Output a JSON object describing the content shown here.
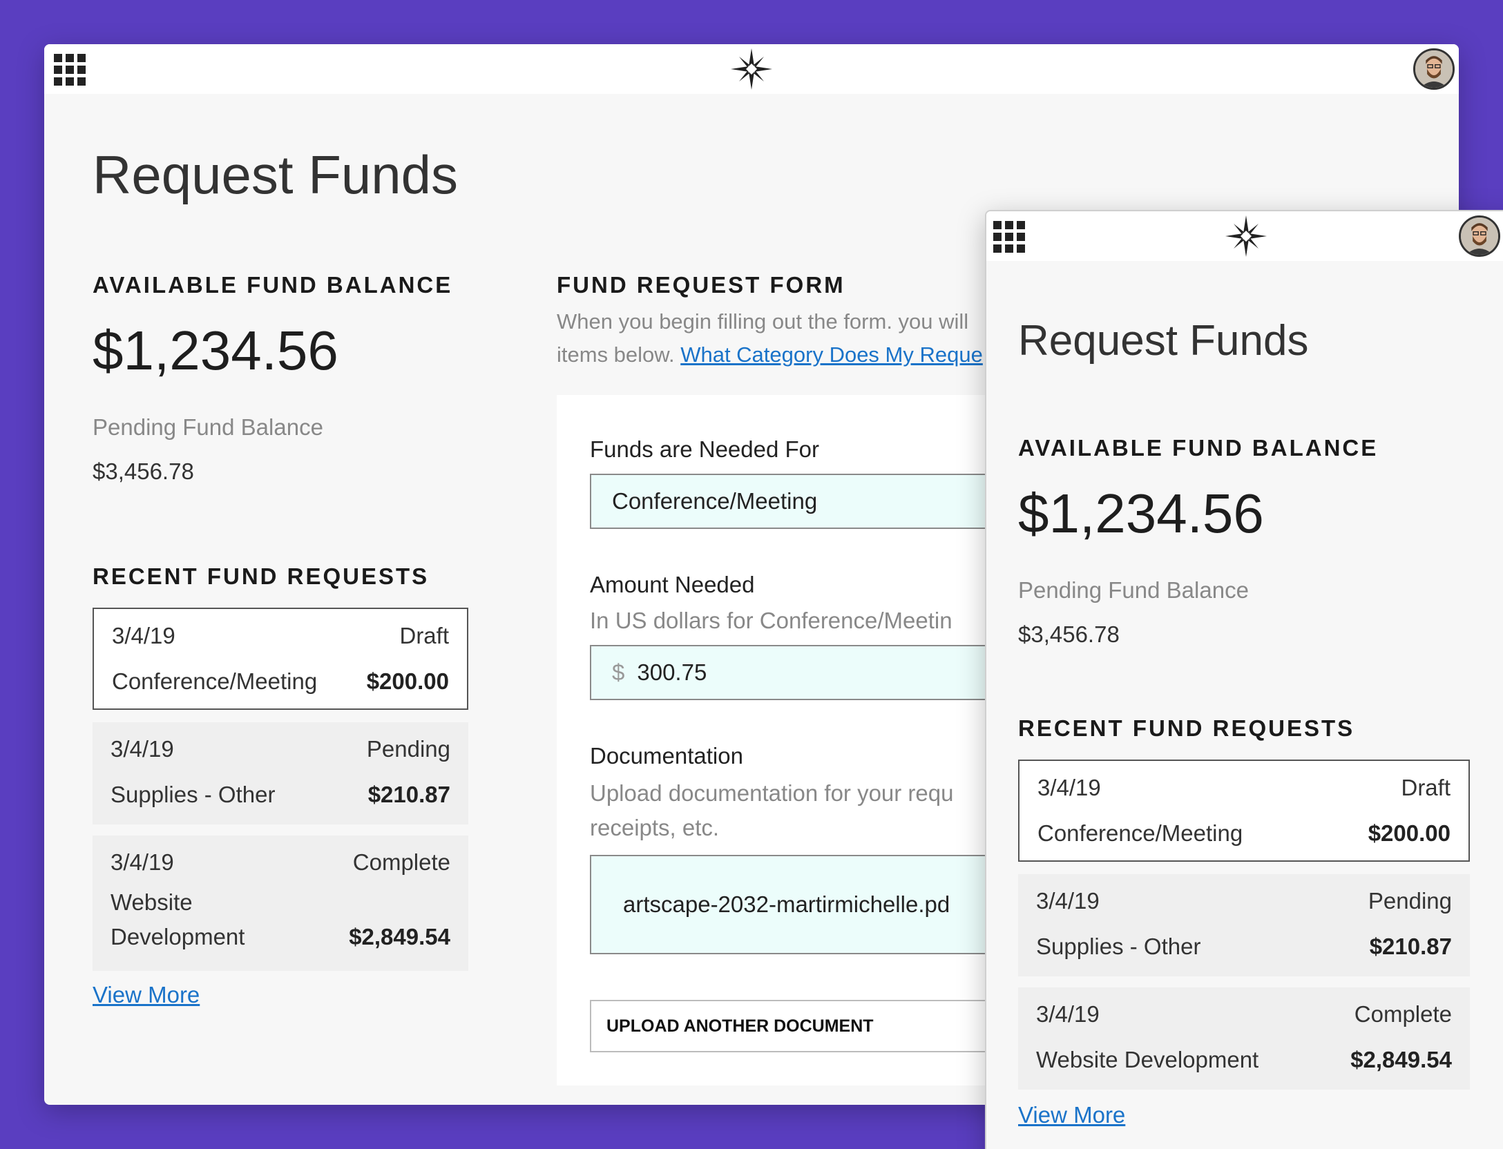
{
  "desktop": {
    "title": "Request Funds",
    "balance": {
      "heading": "AVAILABLE FUND BALANCE",
      "amount": "$1,234.56",
      "pending_label": "Pending Fund Balance",
      "pending_amount": "$3,456.78"
    },
    "recent": {
      "heading": "RECENT FUND REQUESTS",
      "items": [
        {
          "date": "3/4/19",
          "status": "Draft",
          "category": "Conference/Meeting",
          "amount": "$200.00"
        },
        {
          "date": "3/4/19",
          "status": "Pending",
          "category": "Supplies - Other",
          "amount": "$210.87"
        },
        {
          "date": "3/4/19",
          "status": "Complete",
          "category_line1": "Website",
          "category_line2": "Development",
          "amount": "$2,849.54"
        }
      ],
      "view_more": "View More"
    },
    "form": {
      "heading": "FUND REQUEST FORM",
      "intro_line1": "When you begin filling out the form. you will",
      "intro_line2": "items below.",
      "intro_link": "What Category Does My Reque",
      "funds_for_label": "Funds are Needed For",
      "funds_for_value": "Conference/Meeting",
      "amount_label": "Amount Needed",
      "amount_help": "In US dollars for Conference/Meetin",
      "amount_prefix": "$",
      "amount_value": "300.75",
      "doc_label": "Documentation",
      "doc_help_line1": "Upload documentation for your requ",
      "doc_help_line2": "receipts, etc.",
      "doc_file": "artscape-2032-martirmichelle.pd",
      "upload_button": "UPLOAD ANOTHER DOCUMENT"
    }
  },
  "mobile": {
    "title": "Request Funds",
    "balance": {
      "heading": "AVAILABLE FUND BALANCE",
      "amount": "$1,234.56",
      "pending_label": "Pending Fund Balance",
      "pending_amount": "$3,456.78"
    },
    "recent": {
      "heading": "RECENT FUND REQUESTS",
      "items": [
        {
          "date": "3/4/19",
          "status": "Draft",
          "category": "Conference/Meeting",
          "amount": "$200.00"
        },
        {
          "date": "3/4/19",
          "status": "Pending",
          "category": "Supplies - Other",
          "amount": "$210.87"
        },
        {
          "date": "3/4/19",
          "status": "Complete",
          "category": "Website Development",
          "amount": "$2,849.54"
        }
      ],
      "view_more": "View More"
    }
  },
  "icons": {
    "apps": "apps-grid-icon",
    "logo": "compass-star-logo-icon",
    "avatar": "user-avatar"
  },
  "colors": {
    "background": "#5a3ec0",
    "input_fill": "#ecfdfb",
    "link": "#1a73c9"
  }
}
